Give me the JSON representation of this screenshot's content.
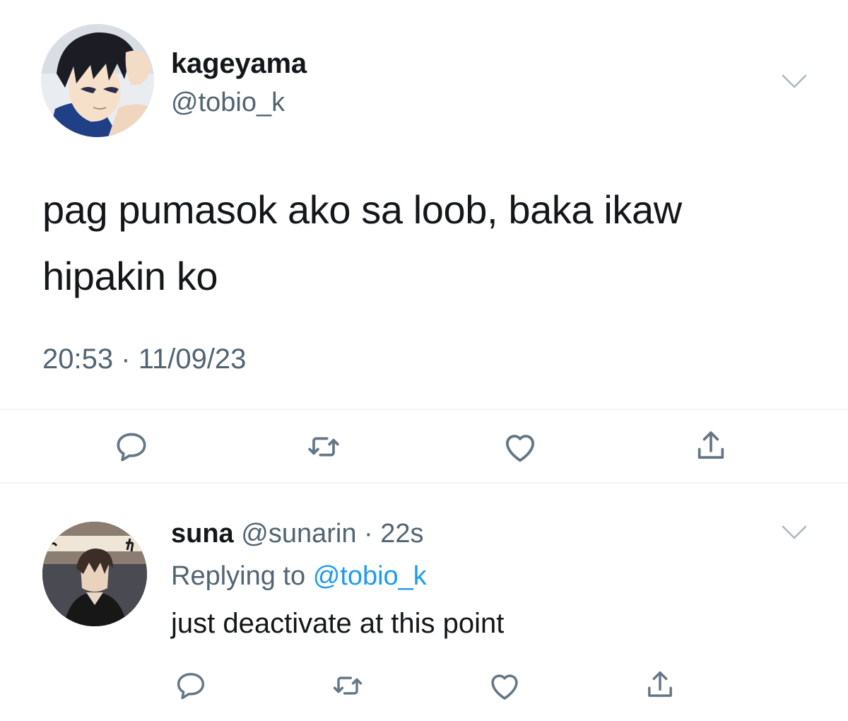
{
  "tweet": {
    "display_name": "kageyama",
    "handle": "@tobio_k",
    "text": "pag pumasok ako sa loob, baka ikaw hipakin ko",
    "time": "20:53",
    "separator": "·",
    "date": "11/09/23",
    "avatar_icon": "anime-character-avatar",
    "menu_icon": "chevron-down-icon",
    "actions": [
      "reply-icon",
      "retweet-icon",
      "like-icon",
      "share-icon"
    ]
  },
  "reply": {
    "display_name": "suna",
    "handle": "@sunarin",
    "separator": "·",
    "time_ago": "22s",
    "replying_prefix": "Replying to",
    "replying_to": "@tobio_k",
    "text": "just deactivate at this point",
    "avatar_icon": "anime-character-avatar",
    "menu_icon": "chevron-down-icon",
    "actions": [
      "reply-icon",
      "retweet-icon",
      "like-icon",
      "share-icon"
    ]
  },
  "colors": {
    "text": "#14171a",
    "secondary": "#536471",
    "link": "#1d9bf0",
    "icon": "#657786",
    "divider": "#f1f3f5"
  }
}
